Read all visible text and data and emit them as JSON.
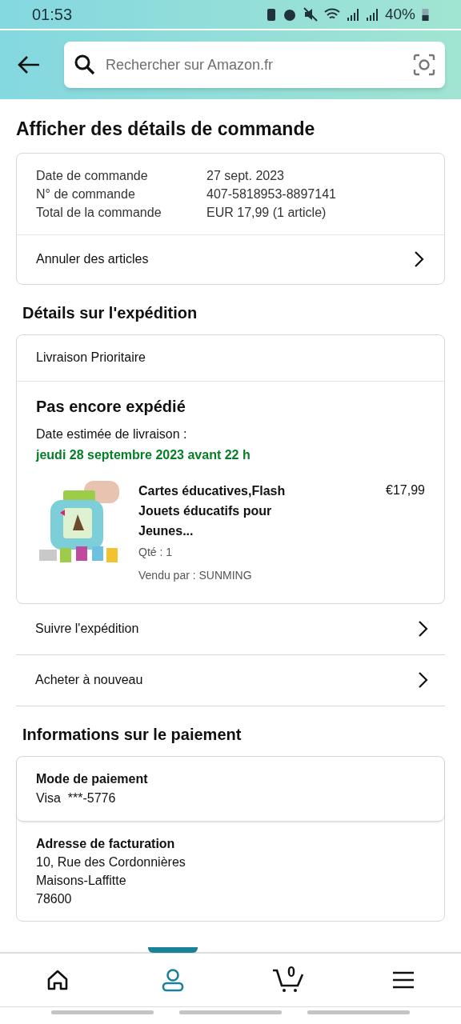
{
  "status_bar": {
    "time": "01:53",
    "battery": "40%"
  },
  "search": {
    "placeholder": "Rechercher sur Amazon.fr"
  },
  "title": "Afficher des détails de commande",
  "summary": {
    "rows": [
      {
        "label": "Date de commande",
        "value": "27 sept. 2023"
      },
      {
        "label": "N° de commande",
        "value": "407-5818953-8897141"
      },
      {
        "label": "Total de la commande",
        "value": "EUR 17,99 (1 article)"
      }
    ],
    "action": "Annuler des articles"
  },
  "shipping": {
    "heading": "Détails sur l'expédition",
    "method": "Livraison Prioritaire",
    "status": "Pas encore expédié",
    "estimate_label": "Date estimée de livraison :",
    "estimate": "jeudi 28 septembre 2023 avant 22 h",
    "item": {
      "title": "Cartes éducatives,Flash Jouets éducatifs pour Jeunes...",
      "price": "€17,99",
      "qty": "Qté : 1",
      "seller": "Vendu par : SUNMING"
    },
    "actions": [
      "Suivre l'expédition",
      "Acheter à nouveau"
    ]
  },
  "payment": {
    "heading": "Informations sur le paiement",
    "method_label": "Mode de paiement",
    "method": "Visa  ***-5776",
    "billing_label": "Adresse de facturation",
    "billing_lines": [
      "10, Rue des Cordonnières",
      "Maisons-Laffitte",
      "78600"
    ]
  },
  "nav": [
    {
      "kind": "home",
      "selected": false
    },
    {
      "kind": "account",
      "selected": true
    },
    {
      "kind": "cart",
      "selected": false,
      "count": "0"
    },
    {
      "kind": "menu",
      "selected": false
    }
  ]
}
